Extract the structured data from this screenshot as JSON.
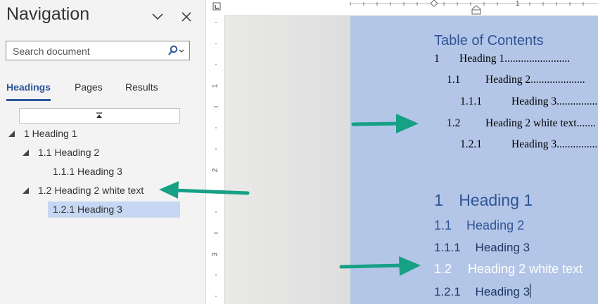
{
  "nav": {
    "title": "Navigation",
    "search_placeholder": "Search document",
    "tabs": [
      "Headings",
      "Pages",
      "Results"
    ],
    "tree": [
      {
        "label": "1 Heading 1",
        "level": 1,
        "expanded": true,
        "selected": false
      },
      {
        "label": "1.1 Heading 2",
        "level": 2,
        "expanded": true,
        "selected": false
      },
      {
        "label": "1.1.1 Heading 3",
        "level": 3,
        "expanded": false,
        "selected": false
      },
      {
        "label": "1.2 Heading 2 white text",
        "level": 2,
        "expanded": true,
        "selected": false
      },
      {
        "label": "1.2.1 Heading 3",
        "level": 3,
        "expanded": false,
        "selected": true
      }
    ]
  },
  "ruler": {
    "top_number": "1",
    "left_numbers": [
      "1",
      "2",
      "3"
    ]
  },
  "document": {
    "toc_title": "Table of Contents",
    "toc": [
      {
        "num": "1",
        "text": "Heading 1"
      },
      {
        "num": "1.1",
        "text": "Heading 2"
      },
      {
        "num": "1.1.1",
        "text": "Heading 3"
      },
      {
        "num": "1.2",
        "text": "Heading 2 white text"
      },
      {
        "num": "1.2.1",
        "text": "Heading 3"
      }
    ],
    "headings": [
      {
        "num": "1",
        "text": "Heading 1"
      },
      {
        "num": "1.1",
        "text": "Heading 2"
      },
      {
        "num": "1.1.1",
        "text": "Heading 3"
      },
      {
        "num": "1.2",
        "text": "Heading 2 white text"
      },
      {
        "num": "1.2.1",
        "text": "Heading 3"
      }
    ]
  },
  "colors": {
    "accent": "#2b579a",
    "page": "#b4c6e7",
    "arrow": "#16a085",
    "selected": "#c5d7f2"
  }
}
